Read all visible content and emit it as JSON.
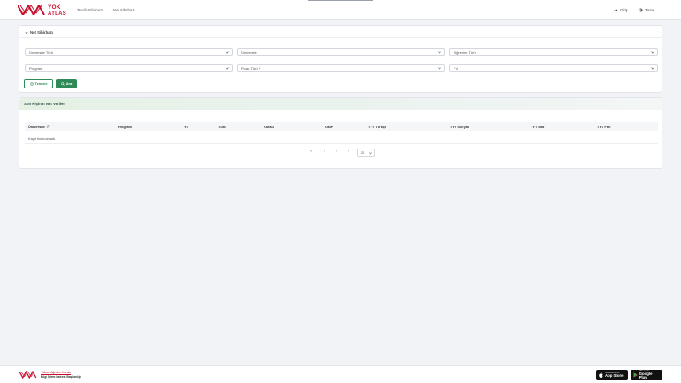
{
  "header": {
    "logo": {
      "top": "YÖK",
      "bottom": "ATLAS"
    },
    "nav": [
      "Tercih Sihirbazı",
      "Net Sihirbazı"
    ],
    "login_label": "Giriş",
    "theme_label": "Tema"
  },
  "filter_panel": {
    "title": "Net Sihirbazı",
    "selects": {
      "university_type": "Üniversite Türü",
      "university": "Üniversite",
      "education_type": "Öğrenim Türü",
      "program": "Program",
      "score_type": "Puan Türü *",
      "year": "Yıl"
    },
    "clear_label": "Temizle",
    "search_label": "Ara"
  },
  "results": {
    "title": "Son Kişinin Net Verileri",
    "columns": [
      "Üniversite",
      "Program",
      "Yıl",
      "Türü",
      "Kotası",
      "OBP",
      "TYT Türkçe",
      "TYT Sosyal",
      "TYT Mat",
      "TYT Fen"
    ],
    "empty_text": "Kayıt bulunamadı.",
    "pagination": {
      "first": "«",
      "prev": "‹",
      "next": "›",
      "last": "»",
      "page_size": "20"
    }
  },
  "footer": {
    "org_name": "Yükseköğretim Kurulu",
    "org_subtitle": "Bilgi İşlem Dairesi Başkanlığı",
    "app_store": {
      "small": "Download on the",
      "big": "App Store"
    },
    "google_play": {
      "small": "GET IT ON",
      "big": "Google Play"
    }
  },
  "colors": {
    "brand_red": "#c8102e",
    "accent_green": "#2e8b57"
  }
}
